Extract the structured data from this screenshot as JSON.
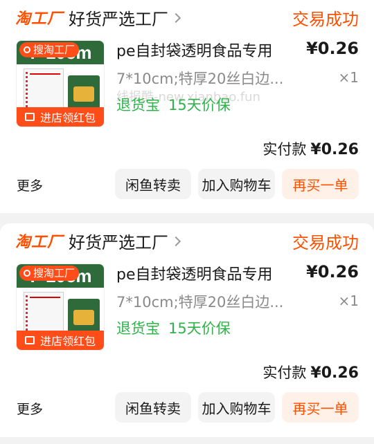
{
  "orders": [
    {
      "shop_logo": "淘工厂",
      "shop_name": "好货严选工厂",
      "status": "交易成功",
      "thumb": {
        "search_text": "搜淘工厂",
        "big_text": "7*10cm",
        "bottom_text": "进店领红包"
      },
      "title": "pe自封袋透明食品专用",
      "price": "¥0.26",
      "spec": "7*10cm;特厚20丝白边...",
      "qty": "×1",
      "guarantee_label": "退货宝",
      "guarantee_value": "15天价保",
      "watermark": "线报酷-new.xianbao.fun",
      "paid_label": "实付款",
      "paid_amount": "¥0.26",
      "more": "更多",
      "btn_resell": "闲鱼转卖",
      "btn_cart": "加入购物车",
      "btn_rebuy": "再买一单"
    },
    {
      "shop_logo": "淘工厂",
      "shop_name": "好货严选工厂",
      "status": "交易成功",
      "thumb": {
        "search_text": "搜淘工厂",
        "big_text": "7*10cm",
        "bottom_text": "进店领红包"
      },
      "title": "pe自封袋透明食品专用",
      "price": "¥0.26",
      "spec": "7*10cm;特厚20丝白边...",
      "qty": "×1",
      "guarantee_label": "退货宝",
      "guarantee_value": "15天价保",
      "paid_label": "实付款",
      "paid_amount": "¥0.26",
      "more": "更多",
      "btn_resell": "闲鱼转卖",
      "btn_cart": "加入购物车",
      "btn_rebuy": "再买一单"
    }
  ],
  "colors": {
    "accent": "#ff5000",
    "green": "#2eb34a",
    "gray_text": "#8a8a8a"
  }
}
